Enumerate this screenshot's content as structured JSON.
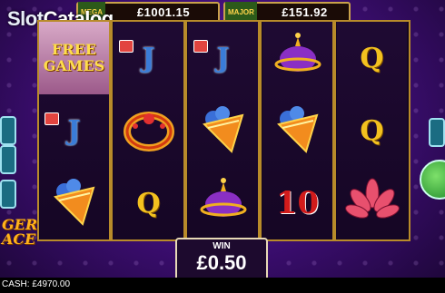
{
  "logo": {
    "text": "SlotCatalog"
  },
  "jackpots": [
    {
      "tag": "MEGA",
      "value": "£1001.15"
    },
    {
      "tag": "MAJOR",
      "value": "£151.92"
    }
  ],
  "game_logo": {
    "line1": "GER",
    "line2": "ACE"
  },
  "reels": [
    [
      {
        "type": "free",
        "lines": [
          "FREE",
          "GAMES"
        ]
      },
      {
        "type": "letter",
        "text": "J",
        "cls": "lj"
      },
      {
        "type": "icon",
        "name": "lamp-icon"
      }
    ],
    [
      {
        "type": "letter",
        "text": "J",
        "cls": "lj"
      },
      {
        "type": "icon",
        "name": "ring-icon"
      },
      {
        "type": "letter",
        "text": "Q",
        "cls": "lq"
      }
    ],
    [
      {
        "type": "letter",
        "text": "J",
        "cls": "lj"
      },
      {
        "type": "icon",
        "name": "lamp-icon"
      },
      {
        "type": "icon",
        "name": "genie-lamp-icon"
      }
    ],
    [
      {
        "type": "icon",
        "name": "genie-lamp-icon"
      },
      {
        "type": "icon",
        "name": "lamp-icon"
      },
      {
        "type": "letter",
        "text": "10",
        "cls": "l10"
      }
    ],
    [
      {
        "type": "letter",
        "text": "Q",
        "cls": "lq"
      },
      {
        "type": "letter",
        "text": "Q",
        "cls": "lq"
      },
      {
        "type": "icon",
        "name": "lotus-icon"
      }
    ]
  ],
  "win": {
    "label": "WIN",
    "amount": "£0.50"
  },
  "cash": {
    "text": "CASH: £4970.00"
  },
  "colors": {
    "reel_border": "#b88b2a",
    "background": "#3a0d6e"
  }
}
